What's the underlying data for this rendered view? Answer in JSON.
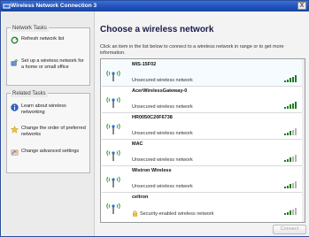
{
  "window": {
    "title": "Wireless Network Connection 3",
    "close_label": "X"
  },
  "sidebar": {
    "network_tasks": {
      "title": "Network Tasks",
      "items": [
        {
          "label": "Refresh network list",
          "icon": "refresh-icon"
        },
        {
          "label": "Set up a wireless network for a home or small office",
          "icon": "setup-wireless-icon"
        }
      ]
    },
    "related_tasks": {
      "title": "Related Tasks",
      "items": [
        {
          "label": "Learn about wireless networking",
          "icon": "info-icon"
        },
        {
          "label": "Change the order of preferred networks",
          "icon": "star-icon"
        },
        {
          "label": "Change advanced settings",
          "icon": "settings-icon"
        }
      ]
    }
  },
  "main": {
    "heading": "Choose a wireless network",
    "instruction": "Click an item in the list below to connect to a wireless network in range or to get more information.",
    "networks": [
      {
        "name": "MIS-15F02",
        "status": "Unsecured wireless network",
        "secured": false,
        "signal": 5
      },
      {
        "name": "AcerWirelessGateway-0",
        "status": "Unsecured wireless network",
        "secured": false,
        "signal": 5
      },
      {
        "name": "HR0050C20F6738",
        "status": "Unsecured wireless network",
        "secured": false,
        "signal": 3
      },
      {
        "name": "MAC",
        "status": "Unsecured wireless network",
        "secured": false,
        "signal": 3
      },
      {
        "name": "Wistron Wireless",
        "status": "Unsecured wireless network",
        "secured": false,
        "signal": 3
      },
      {
        "name": "celtron",
        "status": "Security-enabled wireless network",
        "secured": true,
        "signal": 3
      }
    ],
    "connect_label": "Connect"
  },
  "colors": {
    "title_bar": "#1f4fb8",
    "signal_on": "#2eaa2e",
    "heading": "#1b1b4c"
  }
}
